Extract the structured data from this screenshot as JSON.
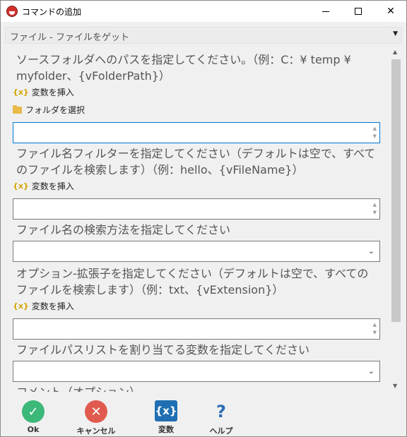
{
  "window": {
    "title": "コマンドの追加",
    "minimize": "–",
    "maximize": "□",
    "close": "✕"
  },
  "command_select": {
    "value": "ファイル - ファイルをゲット",
    "arrow": "▼"
  },
  "fields": {
    "source_label": "ソースフォルダへのパスを指定してください。（例：C：¥ temp ¥",
    "source_label_2": "myfolder、{vFolderPath}）",
    "insert_var": "変数を挿入",
    "select_folder": "フォルダを選択",
    "filter_label": "ファイル名フィルターを指定してください（デフォルトは空で、すべて",
    "filter_label_2": "のファイルを検索します）（例：hello、{vFileName}）",
    "search_method_label": "ファイル名の検索方法を指定してください",
    "ext_label": "オプション-拡張子を指定してください（デフォルトは空で、すべての",
    "ext_label_2": "ファイルを検索します）（例：txt、{vExtension}）",
    "list_var_label": "ファイルパスリストを割り当てる変数を指定してください",
    "comment_label": "コメント（オプション）",
    "source_value": "",
    "filter_value": "",
    "ext_value": "",
    "search_method_value": "",
    "list_var_value": ""
  },
  "footer": {
    "ok": "Ok",
    "cancel": "キャンセル",
    "variables": "変数",
    "help": "ヘルプ",
    "vars_glyph": "{x}",
    "help_glyph": "?",
    "ok_glyph": "✓",
    "cancel_glyph": "✕"
  },
  "colors": {
    "ok": "#3cb878",
    "cancel": "#e05a4e",
    "variables": "#1f6fb2",
    "help": "#2c6eb5",
    "focus": "#0078d7"
  }
}
